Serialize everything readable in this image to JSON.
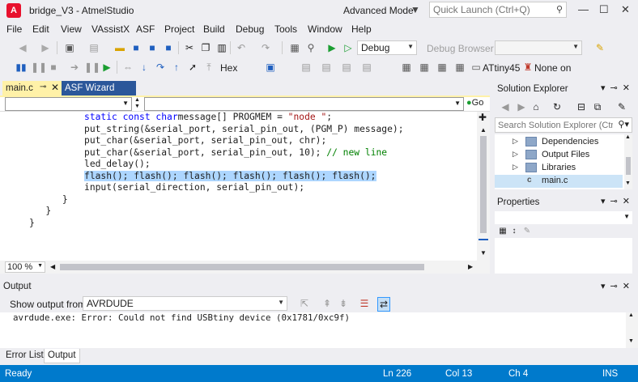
{
  "titlebar": {
    "title": "bridge_V3 - AtmelStudio",
    "advanced_mode": "Advanced Mode",
    "quick_launch_placeholder": "Quick Launch (Ctrl+Q)"
  },
  "menu": [
    "File",
    "Edit",
    "View",
    "VAssistX",
    "ASF",
    "Project",
    "Build",
    "Debug",
    "Tools",
    "Window",
    "Help"
  ],
  "toolbar": {
    "config_value": "Debug",
    "debug_browser": "Debug Browser",
    "hex_label": "Hex",
    "device": "ATtiny45",
    "tool": "None on"
  },
  "doc_tabs": {
    "active": "main.c",
    "other": "ASF Wizard"
  },
  "navbar": {
    "go_label": "Go"
  },
  "code": {
    "lines": [
      {
        "indent": "          ",
        "parts": [
          [
            "kw",
            "static const char"
          ],
          [
            "",
            "message[] PROGMEM = "
          ],
          [
            "str",
            "\"node \""
          ],
          [
            "",
            ";"
          ]
        ]
      },
      {
        "indent": "          ",
        "parts": [
          [
            "",
            "put_string(&serial_port, serial_pin_out, (PGM_P) message);"
          ]
        ]
      },
      {
        "indent": "          ",
        "parts": [
          [
            "",
            "put_char(&serial_port, serial_pin_out, chr);"
          ]
        ]
      },
      {
        "indent": "          ",
        "parts": [
          [
            "",
            "put_char(&serial_port, serial_pin_out, 10); "
          ],
          [
            "cmt",
            "// new line"
          ]
        ]
      },
      {
        "indent": "          ",
        "parts": [
          [
            "",
            "led_delay();"
          ]
        ]
      },
      {
        "indent": "          ",
        "parts": [
          [
            "hl",
            "flash(); flash(); flash(); flash(); flash(); flash();"
          ]
        ]
      },
      {
        "indent": "          ",
        "parts": [
          [
            "",
            "input(serial_direction, serial_pin_out);"
          ]
        ]
      },
      {
        "indent": "      ",
        "parts": [
          [
            "",
            "}"
          ]
        ]
      },
      {
        "indent": "   ",
        "parts": [
          [
            "",
            "}"
          ]
        ]
      },
      {
        "indent": "",
        "parts": [
          [
            "",
            "}"
          ]
        ]
      }
    ]
  },
  "zoom": "100 %",
  "solution_explorer": {
    "title": "Solution Explorer",
    "search_placeholder": "Search Solution Explorer (Ctrl+",
    "items": [
      {
        "label": "Dependencies",
        "expander": "▷"
      },
      {
        "label": "Output Files",
        "expander": "▷"
      },
      {
        "label": "Libraries",
        "expander": "▷"
      },
      {
        "label": "main.c",
        "expander": ""
      }
    ]
  },
  "properties": {
    "title": "Properties"
  },
  "output": {
    "title": "Output",
    "show_from_label": "Show output from:",
    "source": "AVRDUDE",
    "text": "avrdude.exe: Error: Could not find USBtiny device (0x1781/0xc9f)"
  },
  "bottom_tabs": [
    "Error List",
    "Output"
  ],
  "status": {
    "state": "Ready",
    "ln": "Ln 226",
    "col": "Col 13",
    "ch": "Ch 4",
    "mode": "INS"
  },
  "colors": {
    "accent": "#007acc",
    "tab_active": "#fff1a8",
    "asf_tab": "#2b579a",
    "selection": "#add6ff"
  }
}
